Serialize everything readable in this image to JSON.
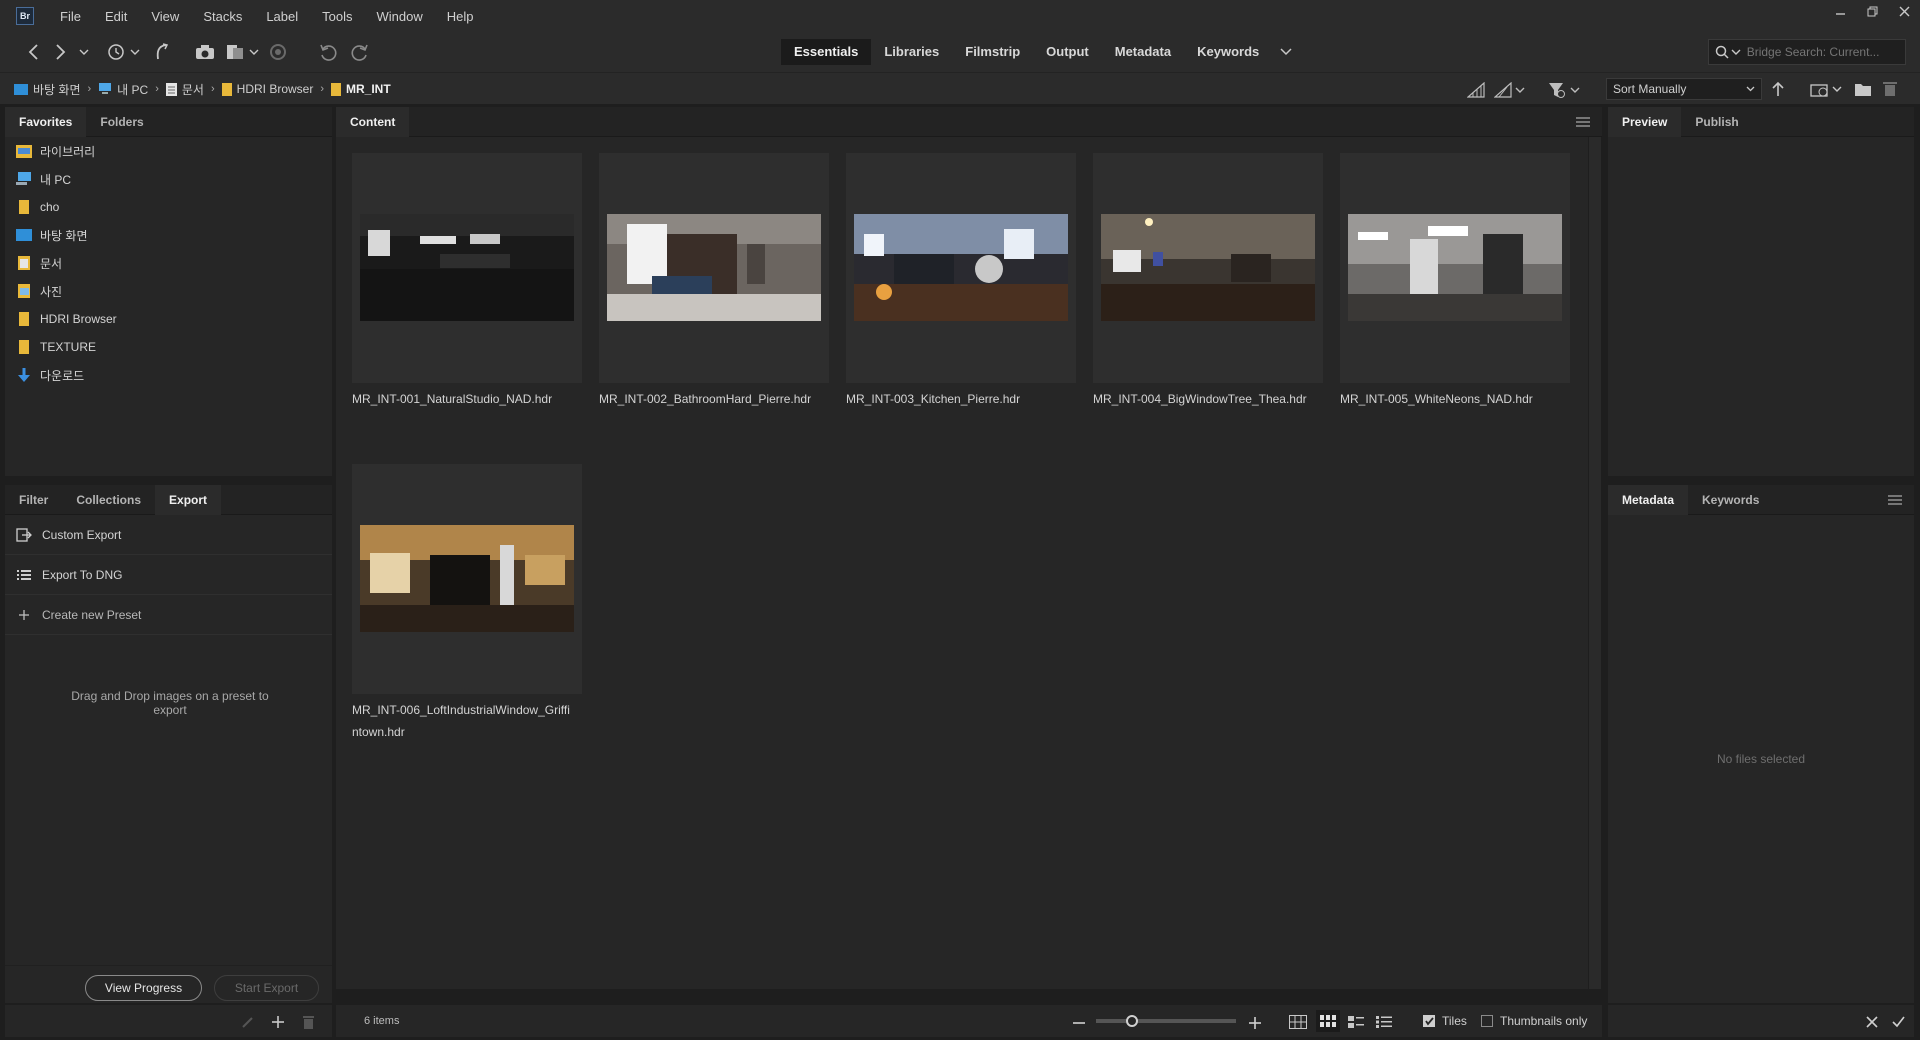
{
  "app": {
    "logo_text": "Br"
  },
  "menu": [
    "File",
    "Edit",
    "View",
    "Stacks",
    "Label",
    "Tools",
    "Window",
    "Help"
  ],
  "workspaces": {
    "tabs": [
      "Essentials",
      "Libraries",
      "Filmstrip",
      "Output",
      "Metadata",
      "Keywords"
    ],
    "active": "Essentials"
  },
  "search": {
    "placeholder": "Bridge Search: Current..."
  },
  "breadcrumb": [
    "바탕 화면",
    "내 PC",
    "문서",
    "HDRI Browser",
    "MR_INT"
  ],
  "sort": {
    "label": "Sort Manually"
  },
  "favorites": {
    "tabs": [
      "Favorites",
      "Folders"
    ],
    "items": [
      {
        "label": "라이브러리",
        "icon": "library-folder-icon"
      },
      {
        "label": "내 PC",
        "icon": "pc-icon"
      },
      {
        "label": "cho",
        "icon": "folder-icon"
      },
      {
        "label": "바탕 화면",
        "icon": "desktop-folder-icon"
      },
      {
        "label": "문서",
        "icon": "documents-folder-icon"
      },
      {
        "label": "사진",
        "icon": "pictures-folder-icon"
      },
      {
        "label": "HDRI Browser",
        "icon": "folder-icon"
      },
      {
        "label": "TEXTURE",
        "icon": "folder-icon"
      },
      {
        "label": "다운로드",
        "icon": "download-icon"
      }
    ]
  },
  "export_panel": {
    "tabs": [
      "Filter",
      "Collections",
      "Export"
    ],
    "items": [
      "Custom Export",
      "Export To DNG",
      "Create new Preset"
    ],
    "drop_hint": "Drag and Drop images on a preset to export",
    "view_progress": "View Progress",
    "start_export": "Start Export"
  },
  "content": {
    "tab": "Content",
    "files": [
      "MR_INT-001_NaturalStudio_NAD.hdr",
      "MR_INT-002_BathroomHard_Pierre.hdr",
      "MR_INT-003_Kitchen_Pierre.hdr",
      "MR_INT-004_BigWindowTree_Thea.hdr",
      "MR_INT-005_WhiteNeons_NAD.hdr",
      "MR_INT-006_LoftIndustrialWindow_Griffi ntown.hdr"
    ],
    "item_count": "6 items",
    "tiles_label": "Tiles",
    "tiles_checked": true,
    "thumbs_only_label": "Thumbnails only",
    "thumbs_only_checked": false
  },
  "preview": {
    "tabs": [
      "Preview",
      "Publish"
    ]
  },
  "metadata": {
    "tabs": [
      "Metadata",
      "Keywords"
    ],
    "empty": "No files selected"
  }
}
